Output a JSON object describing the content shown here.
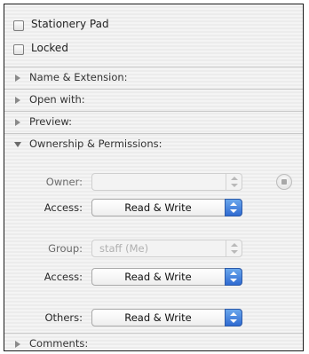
{
  "general": {
    "stationery_pad": {
      "label": "Stationery Pad",
      "checked": false
    },
    "locked": {
      "label": "Locked",
      "checked": false
    }
  },
  "sections": {
    "name_extension": {
      "label": "Name & Extension:",
      "expanded": false
    },
    "open_with": {
      "label": "Open with:",
      "expanded": false
    },
    "preview": {
      "label": "Preview:",
      "expanded": false
    },
    "ownership": {
      "label": "Ownership & Permissions:",
      "expanded": true
    },
    "comments": {
      "label": "Comments:",
      "expanded": false
    }
  },
  "ownership": {
    "owner_label": "Owner:",
    "owner_value": "",
    "owner_access_label": "Access:",
    "owner_access_value": "Read & Write",
    "group_label": "Group:",
    "group_value": "staff (Me)",
    "group_access_label": "Access:",
    "group_access_value": "Read & Write",
    "others_label": "Others:",
    "others_value": "Read & Write",
    "lock_icon": "lock-icon"
  },
  "colors": {
    "accent_blue": "#2f6ad1",
    "panel_bg": "#f1f1f1"
  }
}
